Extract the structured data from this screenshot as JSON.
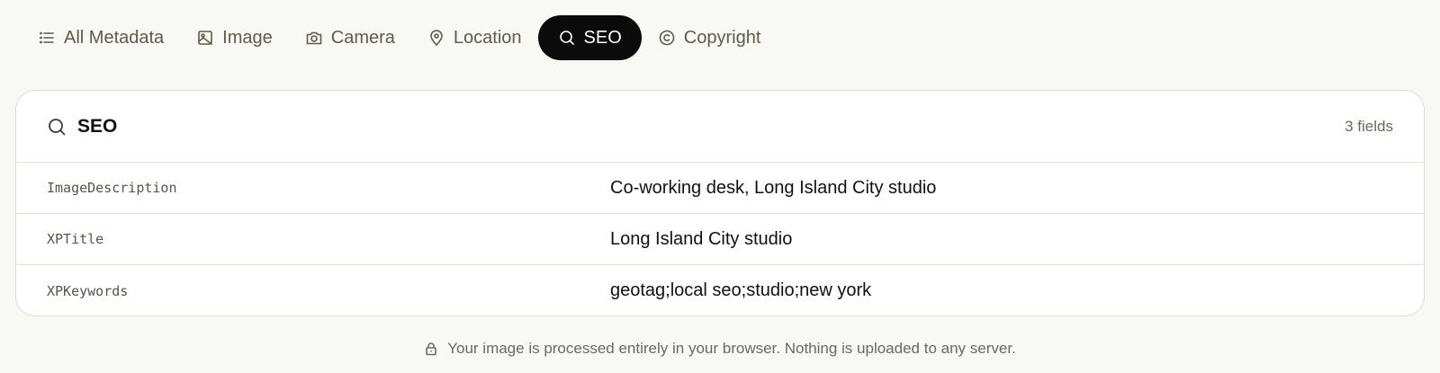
{
  "tabs": [
    {
      "label": "All Metadata",
      "icon": "list-icon",
      "active": false
    },
    {
      "label": "Image",
      "icon": "image-icon",
      "active": false
    },
    {
      "label": "Camera",
      "icon": "camera-icon",
      "active": false
    },
    {
      "label": "Location",
      "icon": "map-pin-icon",
      "active": false
    },
    {
      "label": "SEO",
      "icon": "search-icon",
      "active": true
    },
    {
      "label": "Copyright",
      "icon": "copyright-icon",
      "active": false
    }
  ],
  "panel": {
    "title": "SEO",
    "icon": "search-icon",
    "count": "3 fields",
    "rows": [
      {
        "key": "ImageDescription",
        "value": "Co-working desk, Long Island City studio"
      },
      {
        "key": "XPTitle",
        "value": "Long Island City studio"
      },
      {
        "key": "XPKeywords",
        "value": "geotag;local seo;studio;new york"
      }
    ]
  },
  "footer": {
    "icon": "lock-icon",
    "text": "Your image is processed entirely in your browser. Nothing is uploaded to any server."
  },
  "colors": {
    "background": "#f8f8f4",
    "active_tab": "#0b0b0b",
    "muted_text": "#5e5a4e"
  }
}
